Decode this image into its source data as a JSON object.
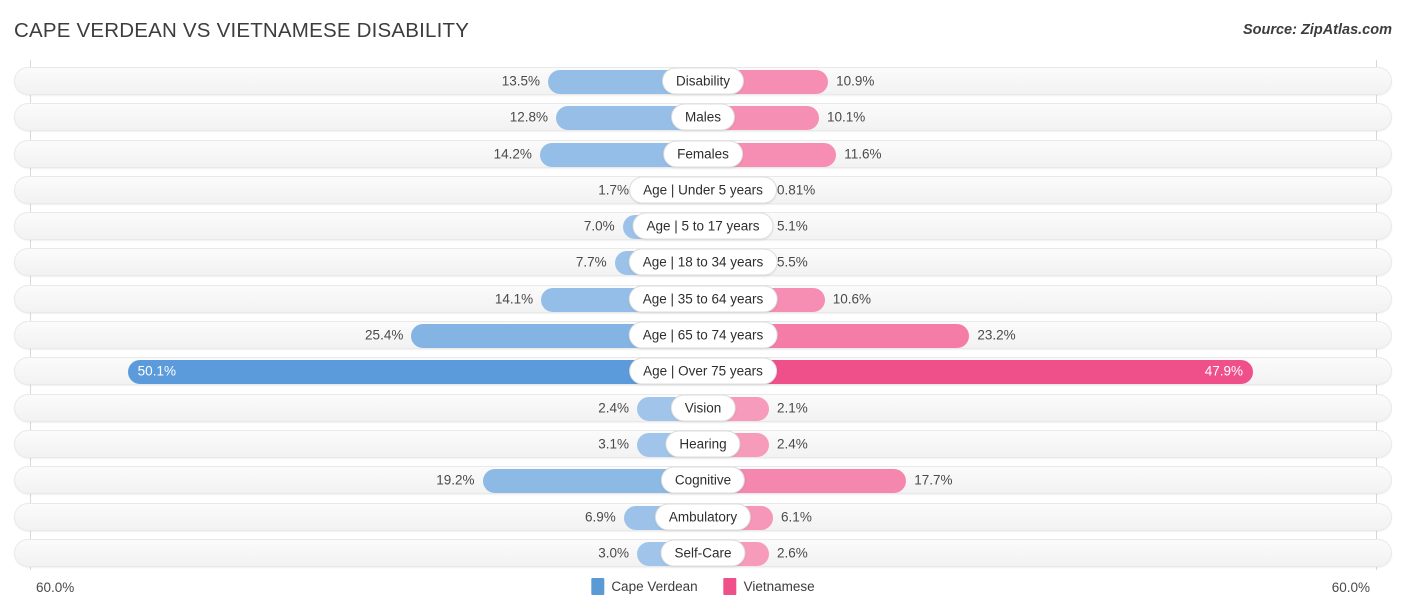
{
  "header": {
    "title": "CAPE VERDEAN VS VIETNAMESE DISABILITY",
    "source": "Source: ZipAtlas.com"
  },
  "footer": {
    "axis_left": "60.0%",
    "axis_right": "60.0%"
  },
  "legend": {
    "items": [
      {
        "label": "Cape Verdean",
        "color": "#5B9BD5"
      },
      {
        "label": "Vietnamese",
        "color": "#F0508A"
      }
    ]
  },
  "colors": {
    "left_light": "#A3C6EA",
    "left_strong": "#5B9BDB",
    "right_light": "#F79DBD",
    "right_strong": "#F0508A",
    "row_bg": "#F5F5F5",
    "axis_line": "#D8D8D8"
  },
  "chart_data": {
    "type": "bar",
    "orientation": "horizontal-diverging",
    "title": "CAPE VERDEAN VS VIETNAMESE DISABILITY",
    "xlabel": "",
    "ylabel": "",
    "axis_max_left": 60.0,
    "axis_max_right": 60.0,
    "xlim": [
      -60.0,
      60.0
    ],
    "grid": false,
    "legend_position": "bottom-center",
    "categories": [
      "Disability",
      "Males",
      "Females",
      "Age | Under 5 years",
      "Age | 5 to 17 years",
      "Age | 18 to 34 years",
      "Age | 35 to 64 years",
      "Age | 65 to 74 years",
      "Age | Over 75 years",
      "Vision",
      "Hearing",
      "Cognitive",
      "Ambulatory",
      "Self-Care"
    ],
    "series": [
      {
        "name": "Cape Verdean",
        "side": "left",
        "values": [
          13.5,
          12.8,
          14.2,
          1.7,
          7.0,
          7.7,
          14.1,
          25.4,
          50.1,
          2.4,
          3.1,
          19.2,
          6.9,
          3.0
        ],
        "labels": [
          "13.5%",
          "12.8%",
          "14.2%",
          "1.7%",
          "7.0%",
          "7.7%",
          "14.1%",
          "25.4%",
          "50.1%",
          "2.4%",
          "3.1%",
          "19.2%",
          "6.9%",
          "3.0%"
        ]
      },
      {
        "name": "Vietnamese",
        "side": "right",
        "values": [
          10.9,
          10.1,
          11.6,
          0.81,
          5.1,
          5.5,
          10.6,
          23.2,
          47.9,
          2.1,
          2.4,
          17.7,
          6.1,
          2.6
        ],
        "labels": [
          "10.9%",
          "10.1%",
          "11.6%",
          "0.81%",
          "5.1%",
          "5.5%",
          "10.6%",
          "23.2%",
          "47.9%",
          "2.1%",
          "2.4%",
          "17.7%",
          "6.1%",
          "2.6%"
        ]
      }
    ]
  }
}
